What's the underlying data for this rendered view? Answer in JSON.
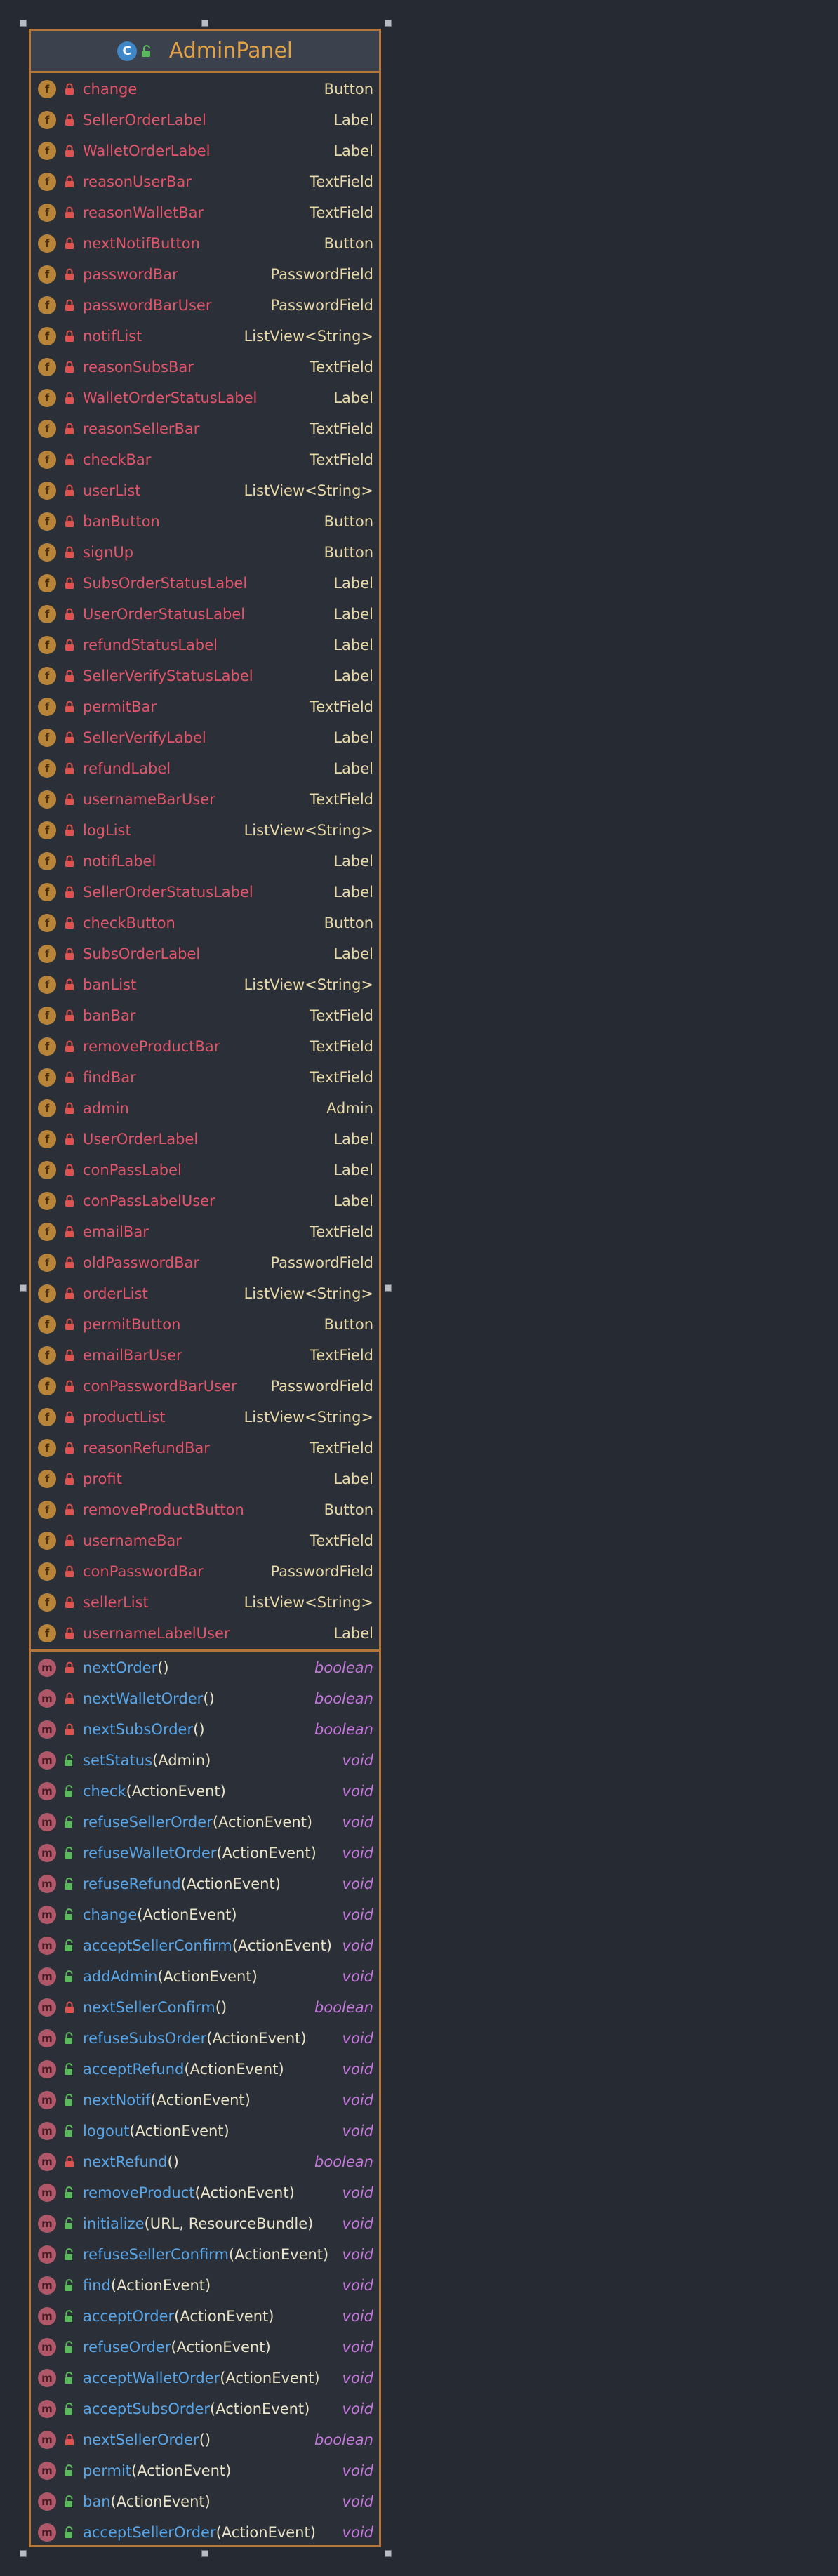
{
  "class_name": "AdminPanel",
  "class_kind_letter": "C",
  "colors": {
    "frame": "#b4763a",
    "field_name": "#e2566b",
    "method_name": "#58a6e8",
    "type": "#e8d9a8",
    "return_type": "#c678dd",
    "title": "#e2a246"
  },
  "fields": [
    {
      "badge": "f",
      "visibility": "private",
      "name": "change",
      "type": "Button"
    },
    {
      "badge": "f",
      "visibility": "private",
      "name": "SellerOrderLabel",
      "type": "Label"
    },
    {
      "badge": "f",
      "visibility": "private",
      "name": "WalletOrderLabel",
      "type": "Label"
    },
    {
      "badge": "f",
      "visibility": "private",
      "name": "reasonUserBar",
      "type": "TextField"
    },
    {
      "badge": "f",
      "visibility": "private",
      "name": "reasonWalletBar",
      "type": "TextField"
    },
    {
      "badge": "f",
      "visibility": "private",
      "name": "nextNotifButton",
      "type": "Button"
    },
    {
      "badge": "f",
      "visibility": "private",
      "name": "passwordBar",
      "type": "PasswordField"
    },
    {
      "badge": "f",
      "visibility": "private",
      "name": "passwordBarUser",
      "type": "PasswordField"
    },
    {
      "badge": "f",
      "visibility": "private",
      "name": "notifList",
      "type": "ListView<String>"
    },
    {
      "badge": "f",
      "visibility": "private",
      "name": "reasonSubsBar",
      "type": "TextField"
    },
    {
      "badge": "f",
      "visibility": "private",
      "name": "WalletOrderStatusLabel",
      "type": "Label"
    },
    {
      "badge": "f",
      "visibility": "private",
      "name": "reasonSellerBar",
      "type": "TextField"
    },
    {
      "badge": "f",
      "visibility": "private",
      "name": "checkBar",
      "type": "TextField"
    },
    {
      "badge": "f",
      "visibility": "private",
      "name": "userList",
      "type": "ListView<String>"
    },
    {
      "badge": "f",
      "visibility": "private",
      "name": "banButton",
      "type": "Button"
    },
    {
      "badge": "f",
      "visibility": "private",
      "name": "signUp",
      "type": "Button"
    },
    {
      "badge": "f",
      "visibility": "private",
      "name": "SubsOrderStatusLabel",
      "type": "Label"
    },
    {
      "badge": "f",
      "visibility": "private",
      "name": "UserOrderStatusLabel",
      "type": "Label"
    },
    {
      "badge": "f",
      "visibility": "private",
      "name": "refundStatusLabel",
      "type": "Label"
    },
    {
      "badge": "f",
      "visibility": "private",
      "name": "SellerVerifyStatusLabel",
      "type": "Label"
    },
    {
      "badge": "f",
      "visibility": "private",
      "name": "permitBar",
      "type": "TextField"
    },
    {
      "badge": "f",
      "visibility": "private",
      "name": "SellerVerifyLabel",
      "type": "Label"
    },
    {
      "badge": "f",
      "visibility": "private",
      "name": "refundLabel",
      "type": "Label"
    },
    {
      "badge": "f",
      "visibility": "private",
      "name": "usernameBarUser",
      "type": "TextField"
    },
    {
      "badge": "f",
      "visibility": "private",
      "name": "logList",
      "type": "ListView<String>"
    },
    {
      "badge": "f",
      "visibility": "private",
      "name": "notifLabel",
      "type": "Label"
    },
    {
      "badge": "f",
      "visibility": "private",
      "name": "SellerOrderStatusLabel",
      "type": "Label"
    },
    {
      "badge": "f",
      "visibility": "private",
      "name": "checkButton",
      "type": "Button"
    },
    {
      "badge": "f",
      "visibility": "private",
      "name": "SubsOrderLabel",
      "type": "Label"
    },
    {
      "badge": "f",
      "visibility": "private",
      "name": "banList",
      "type": "ListView<String>"
    },
    {
      "badge": "f",
      "visibility": "private",
      "name": "banBar",
      "type": "TextField"
    },
    {
      "badge": "f",
      "visibility": "private",
      "name": "removeProductBar",
      "type": "TextField"
    },
    {
      "badge": "f",
      "visibility": "private",
      "name": "findBar",
      "type": "TextField"
    },
    {
      "badge": "f",
      "visibility": "private",
      "name": "admin",
      "type": "Admin"
    },
    {
      "badge": "f",
      "visibility": "private",
      "name": "UserOrderLabel",
      "type": "Label"
    },
    {
      "badge": "f",
      "visibility": "private",
      "name": "conPassLabel",
      "type": "Label"
    },
    {
      "badge": "f",
      "visibility": "private",
      "name": "conPassLabelUser",
      "type": "Label"
    },
    {
      "badge": "f",
      "visibility": "private",
      "name": "emailBar",
      "type": "TextField"
    },
    {
      "badge": "f",
      "visibility": "private",
      "name": "oldPasswordBar",
      "type": "PasswordField"
    },
    {
      "badge": "f",
      "visibility": "private",
      "name": "orderList",
      "type": "ListView<String>"
    },
    {
      "badge": "f",
      "visibility": "private",
      "name": "permitButton",
      "type": "Button"
    },
    {
      "badge": "f",
      "visibility": "private",
      "name": "emailBarUser",
      "type": "TextField"
    },
    {
      "badge": "f",
      "visibility": "private",
      "name": "conPasswordBarUser",
      "type": "PasswordField"
    },
    {
      "badge": "f",
      "visibility": "private",
      "name": "productList",
      "type": "ListView<String>"
    },
    {
      "badge": "f",
      "visibility": "private",
      "name": "reasonRefundBar",
      "type": "TextField"
    },
    {
      "badge": "f",
      "visibility": "private",
      "name": "profit",
      "type": "Label"
    },
    {
      "badge": "f",
      "visibility": "private",
      "name": "removeProductButton",
      "type": "Button"
    },
    {
      "badge": "f",
      "visibility": "private",
      "name": "usernameBar",
      "type": "TextField"
    },
    {
      "badge": "f",
      "visibility": "private",
      "name": "conPasswordBar",
      "type": "PasswordField"
    },
    {
      "badge": "f",
      "visibility": "private",
      "name": "sellerList",
      "type": "ListView<String>"
    },
    {
      "badge": "f",
      "visibility": "private",
      "name": "usernameLabelUser",
      "type": "Label"
    }
  ],
  "methods": [
    {
      "badge": "m",
      "visibility": "private",
      "name": "nextOrder",
      "params": "()",
      "returns": "boolean"
    },
    {
      "badge": "m",
      "visibility": "private",
      "name": "nextWalletOrder",
      "params": "()",
      "returns": "boolean"
    },
    {
      "badge": "m",
      "visibility": "private",
      "name": "nextSubsOrder",
      "params": "()",
      "returns": "boolean"
    },
    {
      "badge": "m",
      "visibility": "public",
      "name": "setStatus",
      "params": "(Admin)",
      "returns": "void"
    },
    {
      "badge": "m",
      "visibility": "public",
      "name": "check",
      "params": "(ActionEvent)",
      "returns": "void"
    },
    {
      "badge": "m",
      "visibility": "public",
      "name": "refuseSellerOrder",
      "params": "(ActionEvent)",
      "returns": "void"
    },
    {
      "badge": "m",
      "visibility": "public",
      "name": "refuseWalletOrder",
      "params": "(ActionEvent)",
      "returns": "void"
    },
    {
      "badge": "m",
      "visibility": "public",
      "name": "refuseRefund",
      "params": "(ActionEvent)",
      "returns": "void"
    },
    {
      "badge": "m",
      "visibility": "public",
      "name": "change",
      "params": "(ActionEvent)",
      "returns": "void"
    },
    {
      "badge": "m",
      "visibility": "public",
      "name": "acceptSellerConfirm",
      "params": "(ActionEvent)",
      "returns": "void"
    },
    {
      "badge": "m",
      "visibility": "public",
      "name": "addAdmin",
      "params": "(ActionEvent)",
      "returns": "void"
    },
    {
      "badge": "m",
      "visibility": "private",
      "name": "nextSellerConfirm",
      "params": "()",
      "returns": "boolean"
    },
    {
      "badge": "m",
      "visibility": "public",
      "name": "refuseSubsOrder",
      "params": "(ActionEvent)",
      "returns": "void"
    },
    {
      "badge": "m",
      "visibility": "public",
      "name": "acceptRefund",
      "params": "(ActionEvent)",
      "returns": "void"
    },
    {
      "badge": "m",
      "visibility": "public",
      "name": "nextNotif",
      "params": "(ActionEvent)",
      "returns": "void"
    },
    {
      "badge": "m",
      "visibility": "public",
      "name": "logout",
      "params": "(ActionEvent)",
      "returns": "void"
    },
    {
      "badge": "m",
      "visibility": "private",
      "name": "nextRefund",
      "params": "()",
      "returns": "boolean"
    },
    {
      "badge": "m",
      "visibility": "public",
      "name": "removeProduct",
      "params": "(ActionEvent)",
      "returns": "void"
    },
    {
      "badge": "m",
      "visibility": "public",
      "name": "initialize",
      "params": "(URL, ResourceBundle)",
      "returns": "void"
    },
    {
      "badge": "m",
      "visibility": "public",
      "name": "refuseSellerConfirm",
      "params": "(ActionEvent)",
      "returns": "void"
    },
    {
      "badge": "m",
      "visibility": "public",
      "name": "find",
      "params": "(ActionEvent)",
      "returns": "void"
    },
    {
      "badge": "m",
      "visibility": "public",
      "name": "acceptOrder",
      "params": "(ActionEvent)",
      "returns": "void"
    },
    {
      "badge": "m",
      "visibility": "public",
      "name": "refuseOrder",
      "params": "(ActionEvent)",
      "returns": "void"
    },
    {
      "badge": "m",
      "visibility": "public",
      "name": "acceptWalletOrder",
      "params": "(ActionEvent)",
      "returns": "void"
    },
    {
      "badge": "m",
      "visibility": "public",
      "name": "acceptSubsOrder",
      "params": "(ActionEvent)",
      "returns": "void"
    },
    {
      "badge": "m",
      "visibility": "private",
      "name": "nextSellerOrder",
      "params": "()",
      "returns": "boolean"
    },
    {
      "badge": "m",
      "visibility": "public",
      "name": "permit",
      "params": "(ActionEvent)",
      "returns": "void"
    },
    {
      "badge": "m",
      "visibility": "public",
      "name": "ban",
      "params": "(ActionEvent)",
      "returns": "void"
    },
    {
      "badge": "m",
      "visibility": "public",
      "name": "acceptSellerOrder",
      "params": "(ActionEvent)",
      "returns": "void"
    }
  ]
}
